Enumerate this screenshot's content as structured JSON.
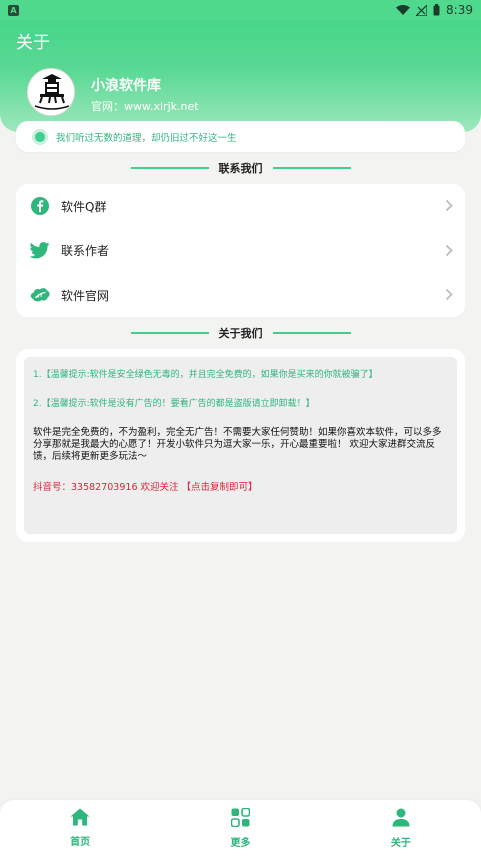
{
  "status_bar": {
    "time": "8:39",
    "badge": "A"
  },
  "header": {
    "title": "关于",
    "app_name": "小浪软件库",
    "website": "官网：www.xlrjk.net"
  },
  "motto": "我们听过无数的道理，却仍旧过不好这一生",
  "contact": {
    "heading": "联系我们",
    "items": [
      {
        "label": "软件Q群",
        "icon": "facebook-icon"
      },
      {
        "label": "联系作者",
        "icon": "twitter-bird-icon"
      },
      {
        "label": "软件官网",
        "icon": "leaf-cloud-icon"
      }
    ]
  },
  "about": {
    "heading": "关于我们",
    "line1": "1.【温馨提示:软件是安全绿色无毒的，并且完全免费的，如果你是买来的你就被骗了】",
    "line2": "2.【温馨提示:软件是没有广告的！要看广告的都是盗版请立即卸载！】",
    "body": "软件是完全免费的，不为盈利，完全无广告！不需要大家任何赞助！如果你喜欢本软件，可以多多分享那就是我最大的心愿了！开发小软件只为逗大家一乐，开心最重要啦！ 欢迎大家进群交流反馈，后续将更新更多玩法～",
    "douyin": "抖音号：33582703916 欢迎关注 【点击复制即可】"
  },
  "nav": {
    "items": [
      {
        "label": "首页",
        "icon": "home-icon"
      },
      {
        "label": "更多",
        "icon": "apps-icon"
      },
      {
        "label": "关于",
        "icon": "user-icon"
      }
    ]
  },
  "colors": {
    "accent": "#3ecf8e",
    "header": "#4fd98c",
    "warning_text": "#e0223a"
  }
}
